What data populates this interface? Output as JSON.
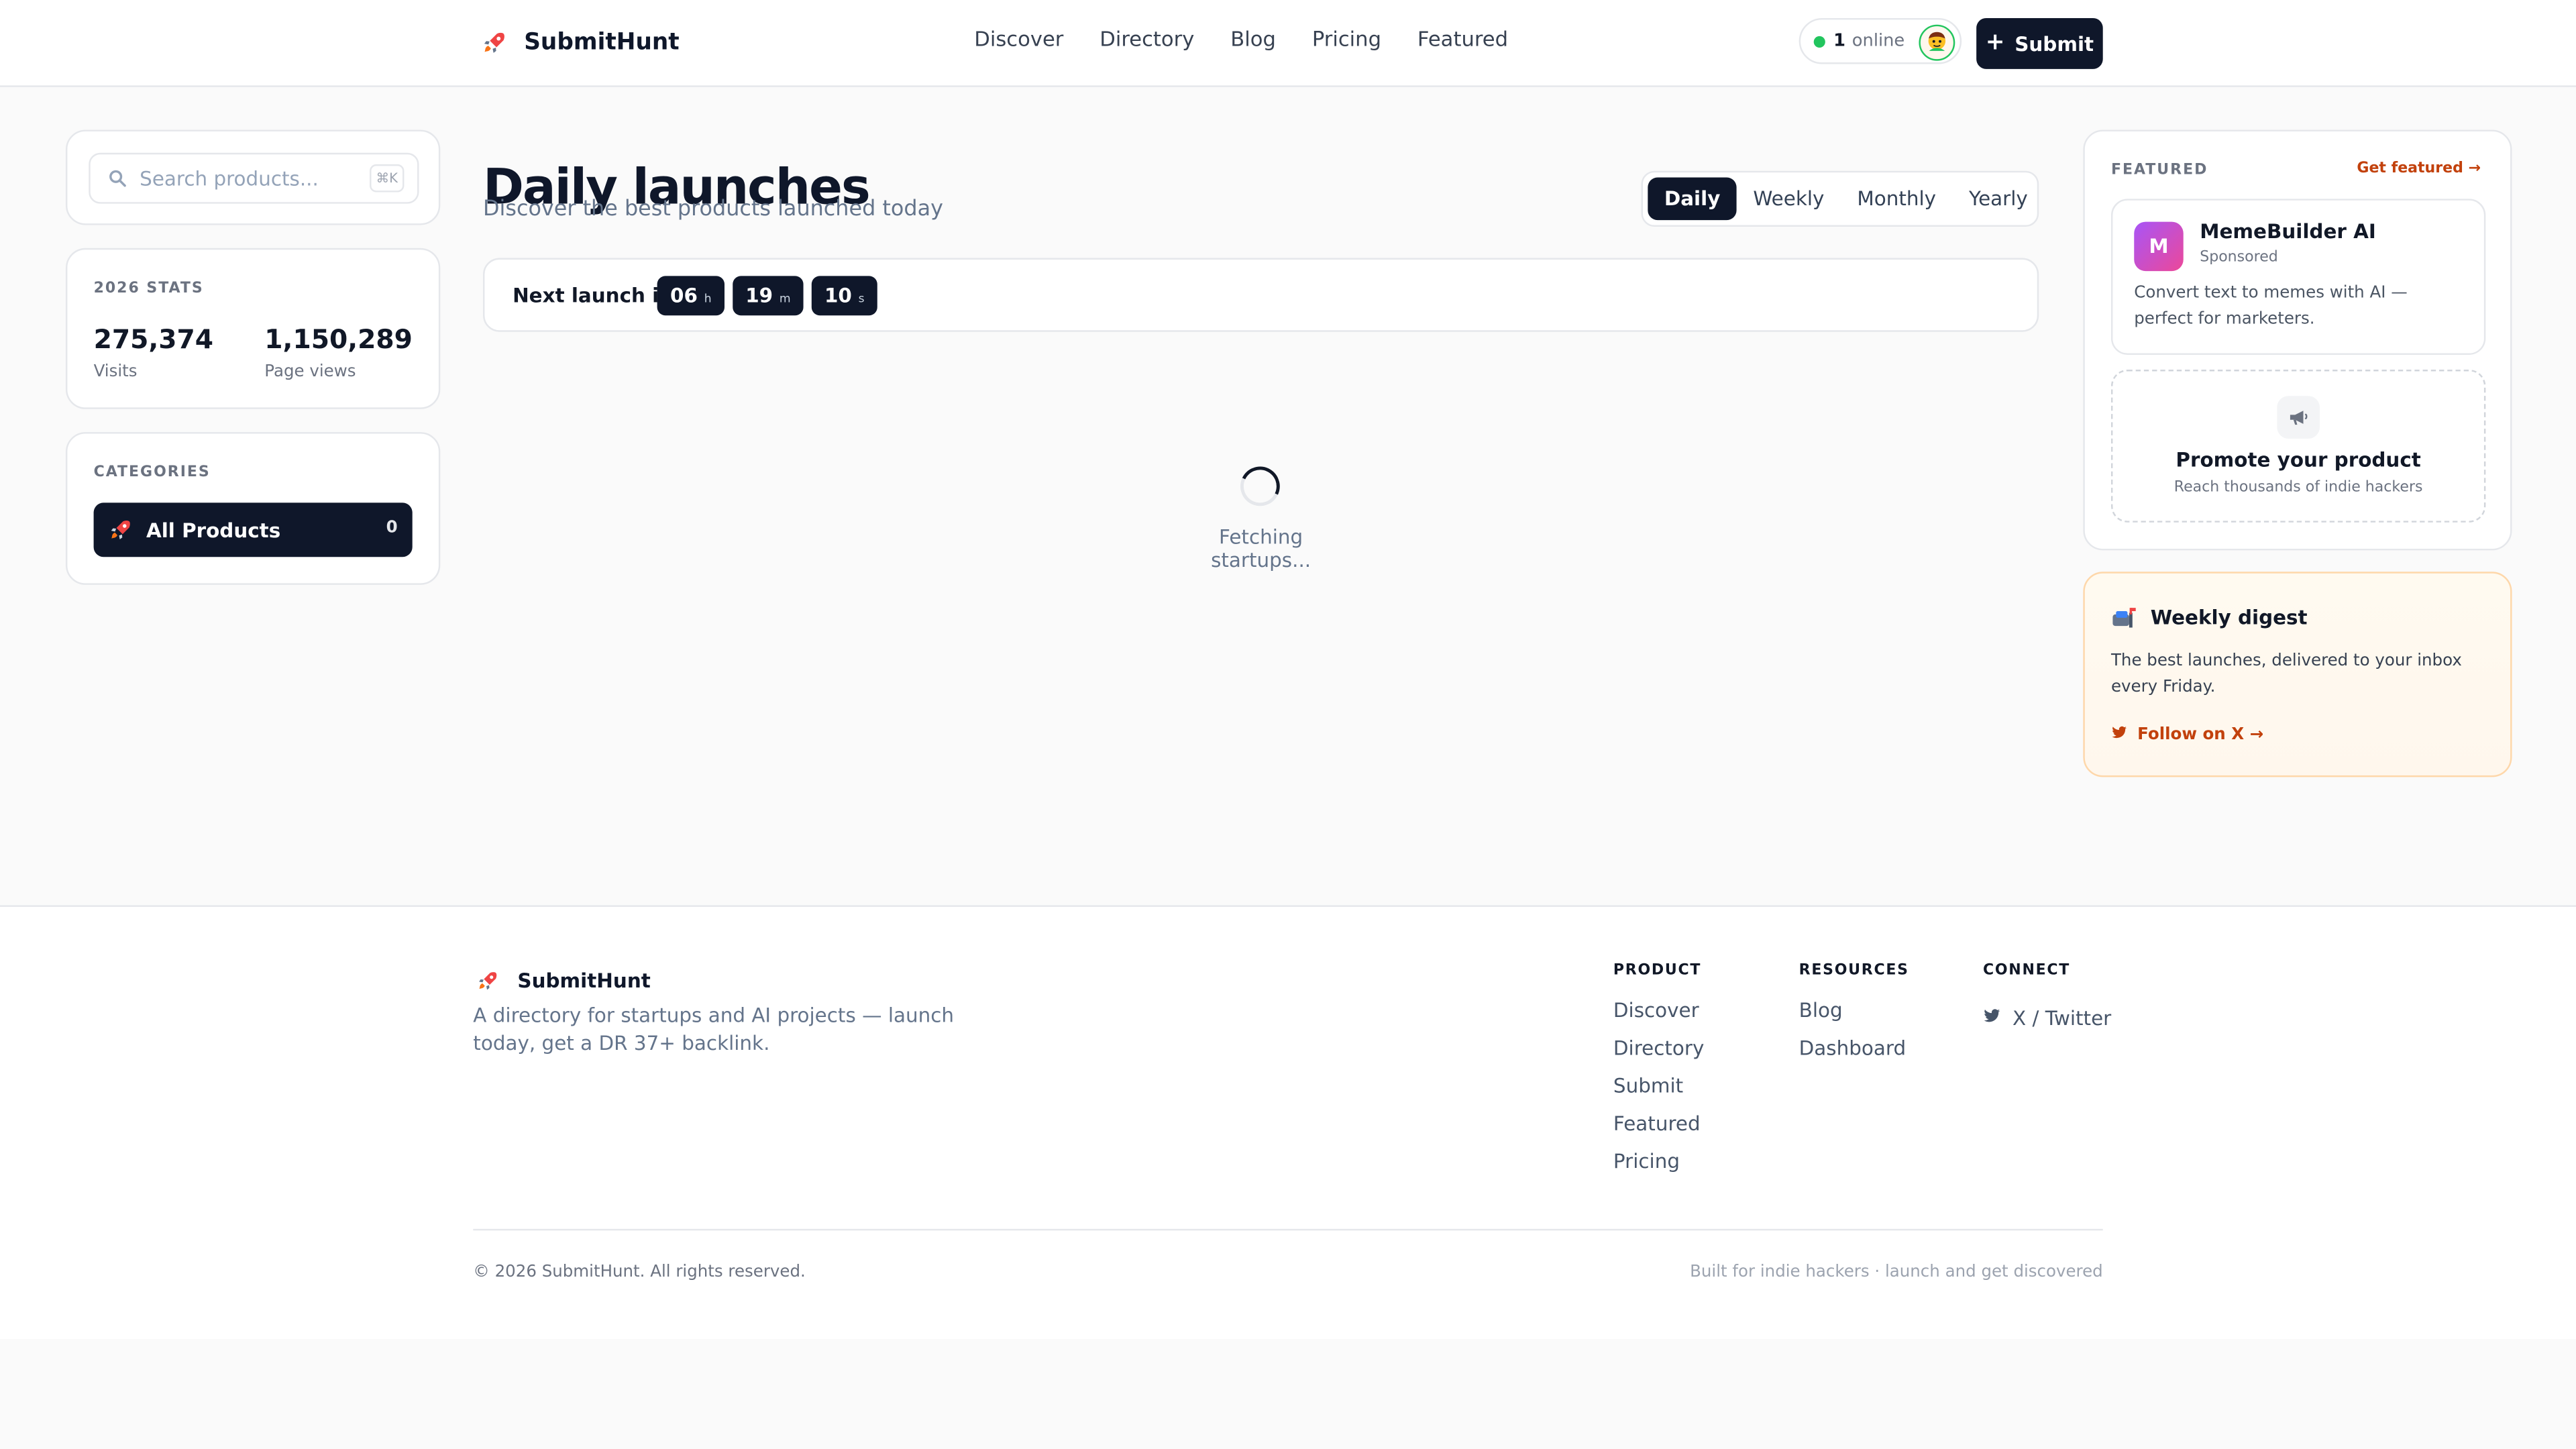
{
  "header": {
    "brand": {
      "name": "SubmitHunt",
      "icon": "rocket-icon"
    },
    "nav": [
      {
        "label": "Discover"
      },
      {
        "label": "Directory"
      },
      {
        "label": "Blog"
      },
      {
        "label": "Pricing"
      },
      {
        "label": "Featured"
      }
    ],
    "online": {
      "count": "1",
      "label": "online",
      "status_color": "#22c55e"
    },
    "submit_label": "Submit"
  },
  "sidebar": {
    "search": {
      "placeholder": "Search products...",
      "shortcut": "⌘K"
    },
    "stats": {
      "title": "2026 STATS",
      "items": [
        {
          "value": "275,374",
          "label": "Visits"
        },
        {
          "value": "1,150,289",
          "label": "Page views"
        }
      ]
    },
    "categories": {
      "title": "CATEGORIES",
      "items": [
        {
          "label": "All Products",
          "count": "0",
          "icon": "rocket-icon",
          "active": true
        }
      ]
    }
  },
  "main": {
    "title": "Daily launches",
    "subtitle": "Discover the best products launched today",
    "tabs": [
      {
        "label": "Daily",
        "active": true
      },
      {
        "label": "Weekly",
        "active": false
      },
      {
        "label": "Monthly",
        "active": false
      },
      {
        "label": "Yearly",
        "active": false
      }
    ],
    "countdown": {
      "label": "Next launch in",
      "parts": [
        {
          "value": "06",
          "unit": "h"
        },
        {
          "value": "19",
          "unit": "m"
        },
        {
          "value": "10",
          "unit": "s"
        }
      ]
    },
    "loading_text": "Fetching startups..."
  },
  "right": {
    "featured": {
      "title": "FEATURED",
      "link": "Get featured →",
      "product": {
        "initial": "M",
        "name": "MemeBuilder AI",
        "tag": "Sponsored",
        "description": "Convert text to memes with AI — perfect for marketers."
      },
      "promote": {
        "title": "Promote your product",
        "subtitle": "Reach thousands of indie hackers",
        "icon": "megaphone-icon"
      }
    },
    "digest": {
      "title": "Weekly digest",
      "text": "The best launches, delivered to your inbox every Friday.",
      "link": "Follow on X →",
      "icon": "mailbox-icon"
    }
  },
  "footer": {
    "brand": "SubmitHunt",
    "description": "A directory for startups and AI projects — launch today, get a DR 37+ backlink.",
    "columns": [
      {
        "title": "PRODUCT",
        "links": [
          "Discover",
          "Directory",
          "Submit",
          "Featured",
          "Pricing"
        ]
      },
      {
        "title": "RESOURCES",
        "links": [
          "Blog",
          "Dashboard"
        ]
      },
      {
        "title": "CONNECT",
        "links": [
          "X / Twitter"
        ]
      }
    ],
    "copyright": "© 2026 SubmitHunt. All rights reserved.",
    "tagline": "Built for indie hackers · launch and get discovered"
  },
  "colors": {
    "primary": "#0f172a",
    "accent": "#c2410c",
    "background": "#fafafa",
    "border": "#e5e7eb"
  }
}
